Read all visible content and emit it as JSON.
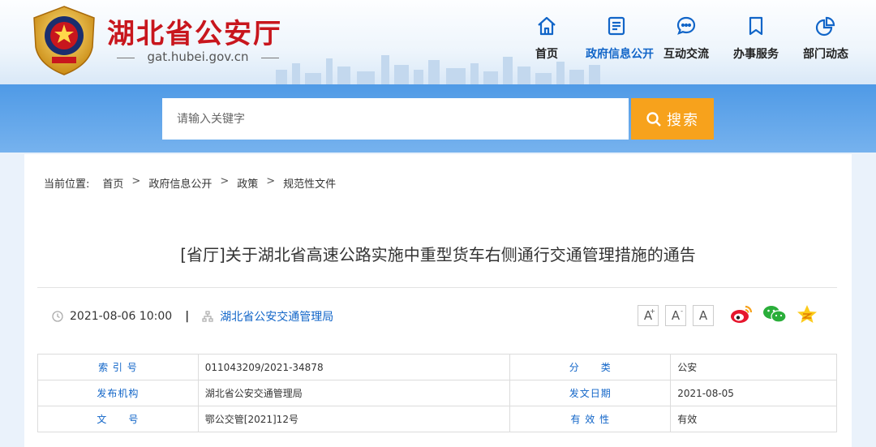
{
  "header": {
    "site_title": "湖北省公安厅",
    "site_url": "gat.hubei.gov.cn",
    "nav": [
      {
        "label": "首页",
        "icon": "home-icon"
      },
      {
        "label": "政府信息公开",
        "icon": "document-icon",
        "active": true
      },
      {
        "label": "互动交流",
        "icon": "chat-icon"
      },
      {
        "label": "办事服务",
        "icon": "bookmark-icon"
      },
      {
        "label": "部门动态",
        "icon": "pie-chart-icon"
      }
    ]
  },
  "search": {
    "placeholder": "请输入关键字",
    "button_label": "搜索"
  },
  "breadcrumb": {
    "lead": "当前位置:",
    "items": [
      "首页",
      "政府信息公开",
      "政策",
      "规范性文件"
    ]
  },
  "article": {
    "title": "[省厅]关于湖北省高速公路实施中重型货车右侧通行交通管理措施的通告",
    "datetime": "2021-08-06 10:00",
    "divider": "|",
    "publisher": "湖北省公安交通管理局"
  },
  "tools": {
    "font_buttons": [
      "A",
      "A",
      "A"
    ]
  },
  "info_table": {
    "rows": [
      {
        "k1": "索 引 号",
        "v1": "011043209/2021-34878",
        "k2": "分　　类",
        "v2": "公安"
      },
      {
        "k1": "发布机构",
        "v1": "湖北省公安交通管理局",
        "k2": "发文日期",
        "v2": "2021-08-05"
      },
      {
        "k1": "文　　号",
        "v1": "鄂公交管[2021]12号",
        "k2": "有 效 性",
        "v2": "有效"
      }
    ]
  },
  "colors": {
    "brand_red": "#c8161d",
    "accent_blue": "#1165c8",
    "search_orange": "#f7a21c"
  }
}
